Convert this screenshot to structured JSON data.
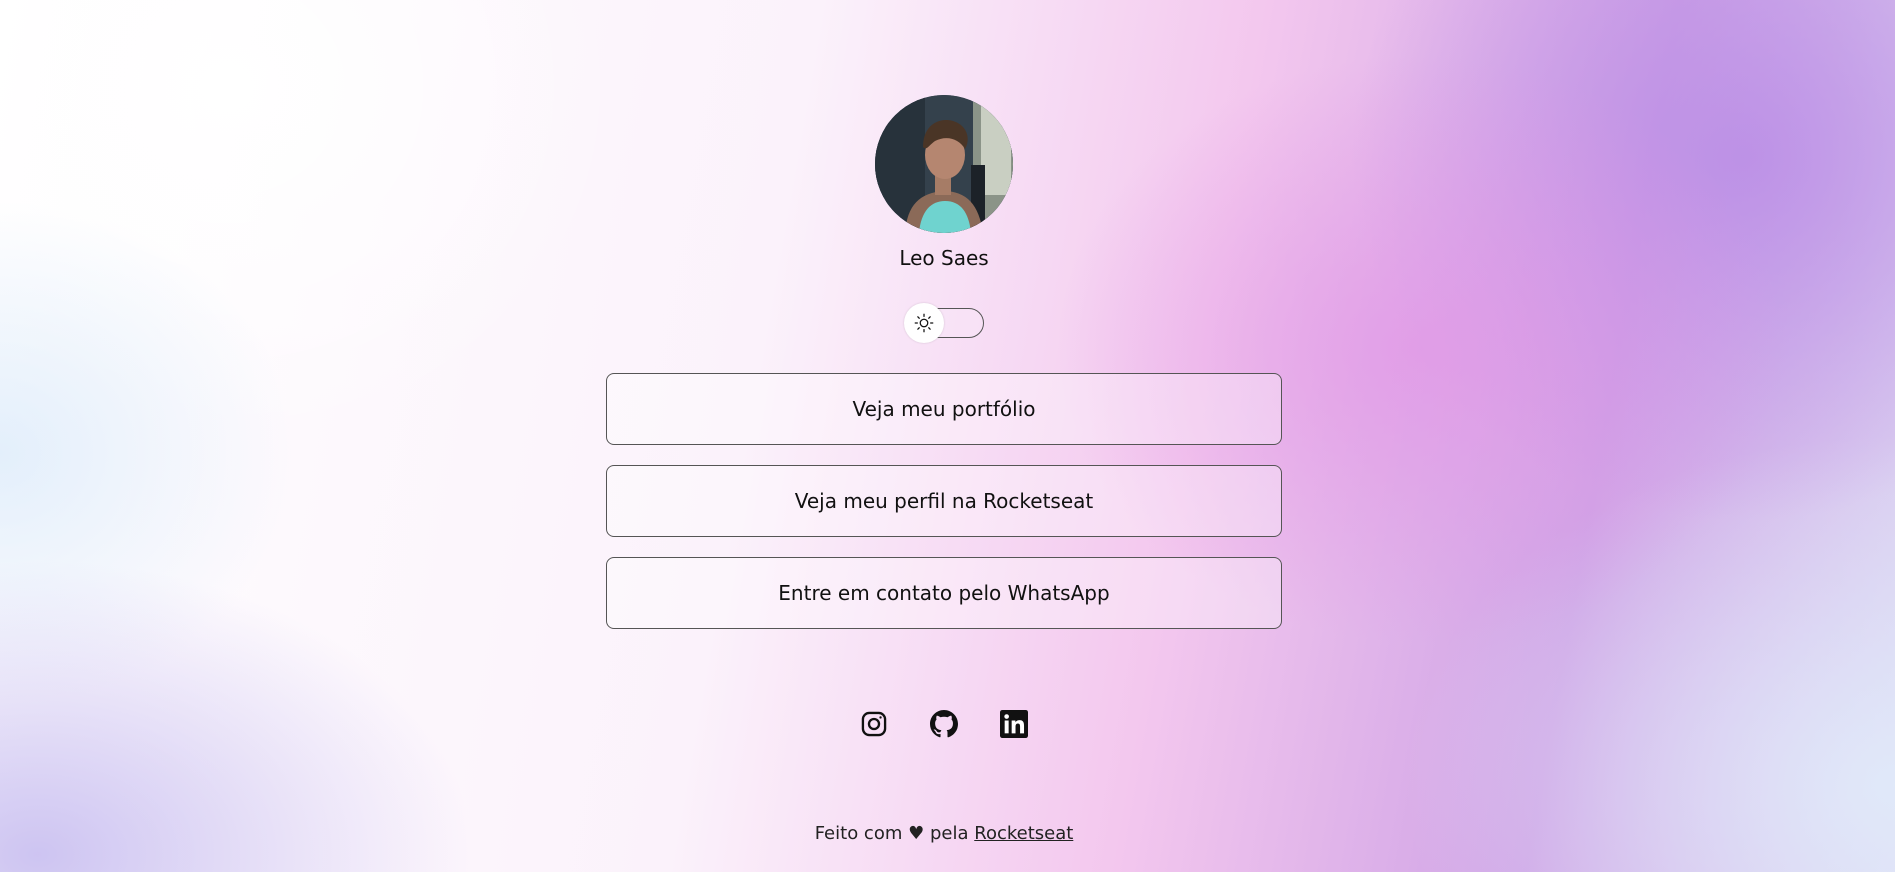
{
  "profile": {
    "name": "Leo Saes",
    "avatar_alt": "Leo Saes"
  },
  "theme_toggle": {
    "icon": "sun-icon",
    "state": "light"
  },
  "links": [
    {
      "label": "Veja meu portfólio"
    },
    {
      "label": "Veja meu perfil na Rocketseat"
    },
    {
      "label": "Entre em contato pelo WhatsApp"
    }
  ],
  "social": [
    {
      "icon": "instagram-icon"
    },
    {
      "icon": "github-icon"
    },
    {
      "icon": "linkedin-icon"
    }
  ],
  "footer": {
    "prefix": "Feito com",
    "heart": "♥",
    "middle": "pela",
    "link_text": "Rocketseat"
  },
  "colors": {
    "text": "#111111",
    "button_border": "#555555",
    "accent_pink": "#f3c7ee",
    "accent_purple": "#cfa3e6"
  }
}
